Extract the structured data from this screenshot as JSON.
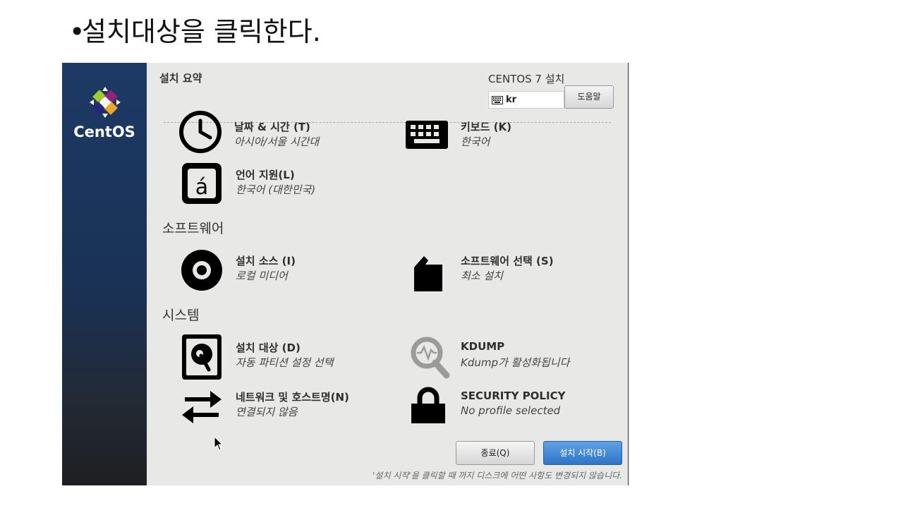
{
  "slide": {
    "bullet": "설치대상을 클릭한다."
  },
  "sidebar": {
    "brand": "CentOS"
  },
  "header": {
    "title": "설치 요약",
    "product": "CENTOS 7 설치",
    "keyboard_layout": "kr",
    "help_label": "도움말"
  },
  "sections": {
    "software": "소프트웨어",
    "system": "시스템"
  },
  "spokes": {
    "datetime": {
      "title": "날짜 & 시간 (T)",
      "status": "아시아/서울 시간대",
      "icon": "clock-icon"
    },
    "keyboard": {
      "title": "키보드 (K)",
      "status": "한국어",
      "icon": "keyboard-icon"
    },
    "language": {
      "title": "언어 지원(L)",
      "status": "한국어 (대한민국)",
      "icon": "language-icon"
    },
    "source": {
      "title": "설치 소스 (I)",
      "status": "로컬 미디어",
      "icon": "disc-icon"
    },
    "software": {
      "title": "소프트웨어 선택 (S)",
      "status": "최소 설치",
      "icon": "package-icon"
    },
    "destination": {
      "title": "설치 대상 (D)",
      "status": "자동 파티션 설정 선택",
      "icon": "harddisk-icon"
    },
    "kdump": {
      "title": "KDUMP",
      "status": "Kdump가 활성화됩니다",
      "icon": "magnifier-icon"
    },
    "network": {
      "title": "네트워크 및 호스트명(N)",
      "status": "연결되지 않음",
      "icon": "network-arrows-icon"
    },
    "security": {
      "title": "SECURITY POLICY",
      "status": "No profile selected",
      "icon": "lock-icon"
    }
  },
  "footer": {
    "quit_label": "종료(Q)",
    "begin_label": "설치 시작(B)",
    "note": "'설치 시작'을 클릭할 때 까지 디스크에 어떤 사항도 변경되지 않습니다."
  },
  "colors": {
    "sidebar_top": "#1c3a66",
    "primary_button": "#3a80d2",
    "window_bg": "#e8e8e7"
  }
}
